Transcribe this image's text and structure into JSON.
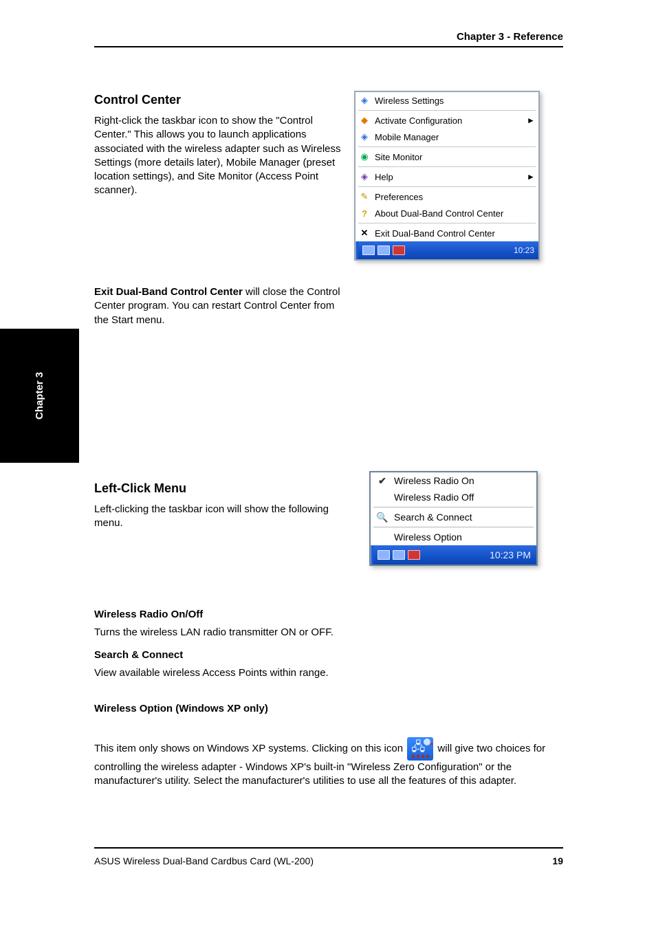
{
  "chapter": {
    "header": "Chapter 3 - Reference",
    "side_tab": "Chapter 3"
  },
  "section1": {
    "heading": "Control Center",
    "p1": "Right-click the taskbar icon to show the \"Control Center.\" This allows you to launch applications associated with the wireless adapter such as Wireless Settings (more details later), Mobile Manager (preset location settings), and Site Monitor (Access Point scanner).",
    "p2_prefix": "Exit Dual-Band Control Center",
    "p2_rest": " will close the Control Center program. You can restart Control Center from the Start menu."
  },
  "section2": {
    "heading": "Left-Click Menu",
    "p1": "Left-clicking the taskbar icon will show the following menu."
  },
  "section3": {
    "h3_1": "Wireless Radio On/Off",
    "p3_1": "Turns the wireless LAN radio transmitter ON or OFF.",
    "h3_2": "Search & Connect",
    "p3_2": "View available wireless Access Points within range.",
    "h3_3": "Wireless Option (Windows XP only)",
    "p3_3_before_icon": "This item only shows on Windows XP systems. Clicking on this icon ",
    "p3_3_after_icon": " will give two choices for controlling the wireless adapter - Windows XP's built-in \"Wireless Zero Configuration\" or the manufacturer's utility. Select the manufacturer's utilities to use all the features of this adapter."
  },
  "menu1": {
    "items": [
      {
        "label": "Wireless Settings",
        "icon": "wireless",
        "submenu": false
      },
      {
        "sep": true
      },
      {
        "label": "Activate Configuration",
        "icon": "diamond",
        "submenu": true
      },
      {
        "label": "Mobile Manager",
        "icon": "wireless",
        "submenu": false
      },
      {
        "sep": true
      },
      {
        "label": "Site Monitor",
        "icon": "globe",
        "submenu": false
      },
      {
        "sep": true
      },
      {
        "label": "Help",
        "icon": "book",
        "submenu": true
      },
      {
        "sep": true
      },
      {
        "label": "Preferences",
        "icon": "pencil",
        "submenu": false
      },
      {
        "label": "About Dual-Band Control Center",
        "icon": "help",
        "submenu": false
      },
      {
        "sep": true
      },
      {
        "label": "Exit Dual-Band Control Center",
        "icon": "x",
        "submenu": false
      }
    ],
    "taskbar_time": "10:23"
  },
  "menu2": {
    "items": [
      {
        "label": "Wireless Radio On",
        "icon": "check"
      },
      {
        "label": "Wireless Radio Off",
        "icon": ""
      },
      {
        "sep": true
      },
      {
        "label": "Search & Connect",
        "icon": "mag"
      },
      {
        "sep": true
      },
      {
        "label": "Wireless Option",
        "icon": ""
      }
    ],
    "taskbar_time": "10:23 PM"
  },
  "footer": {
    "left": "ASUS Wireless Dual-Band Cardbus Card (WL-200)",
    "right": "19"
  }
}
